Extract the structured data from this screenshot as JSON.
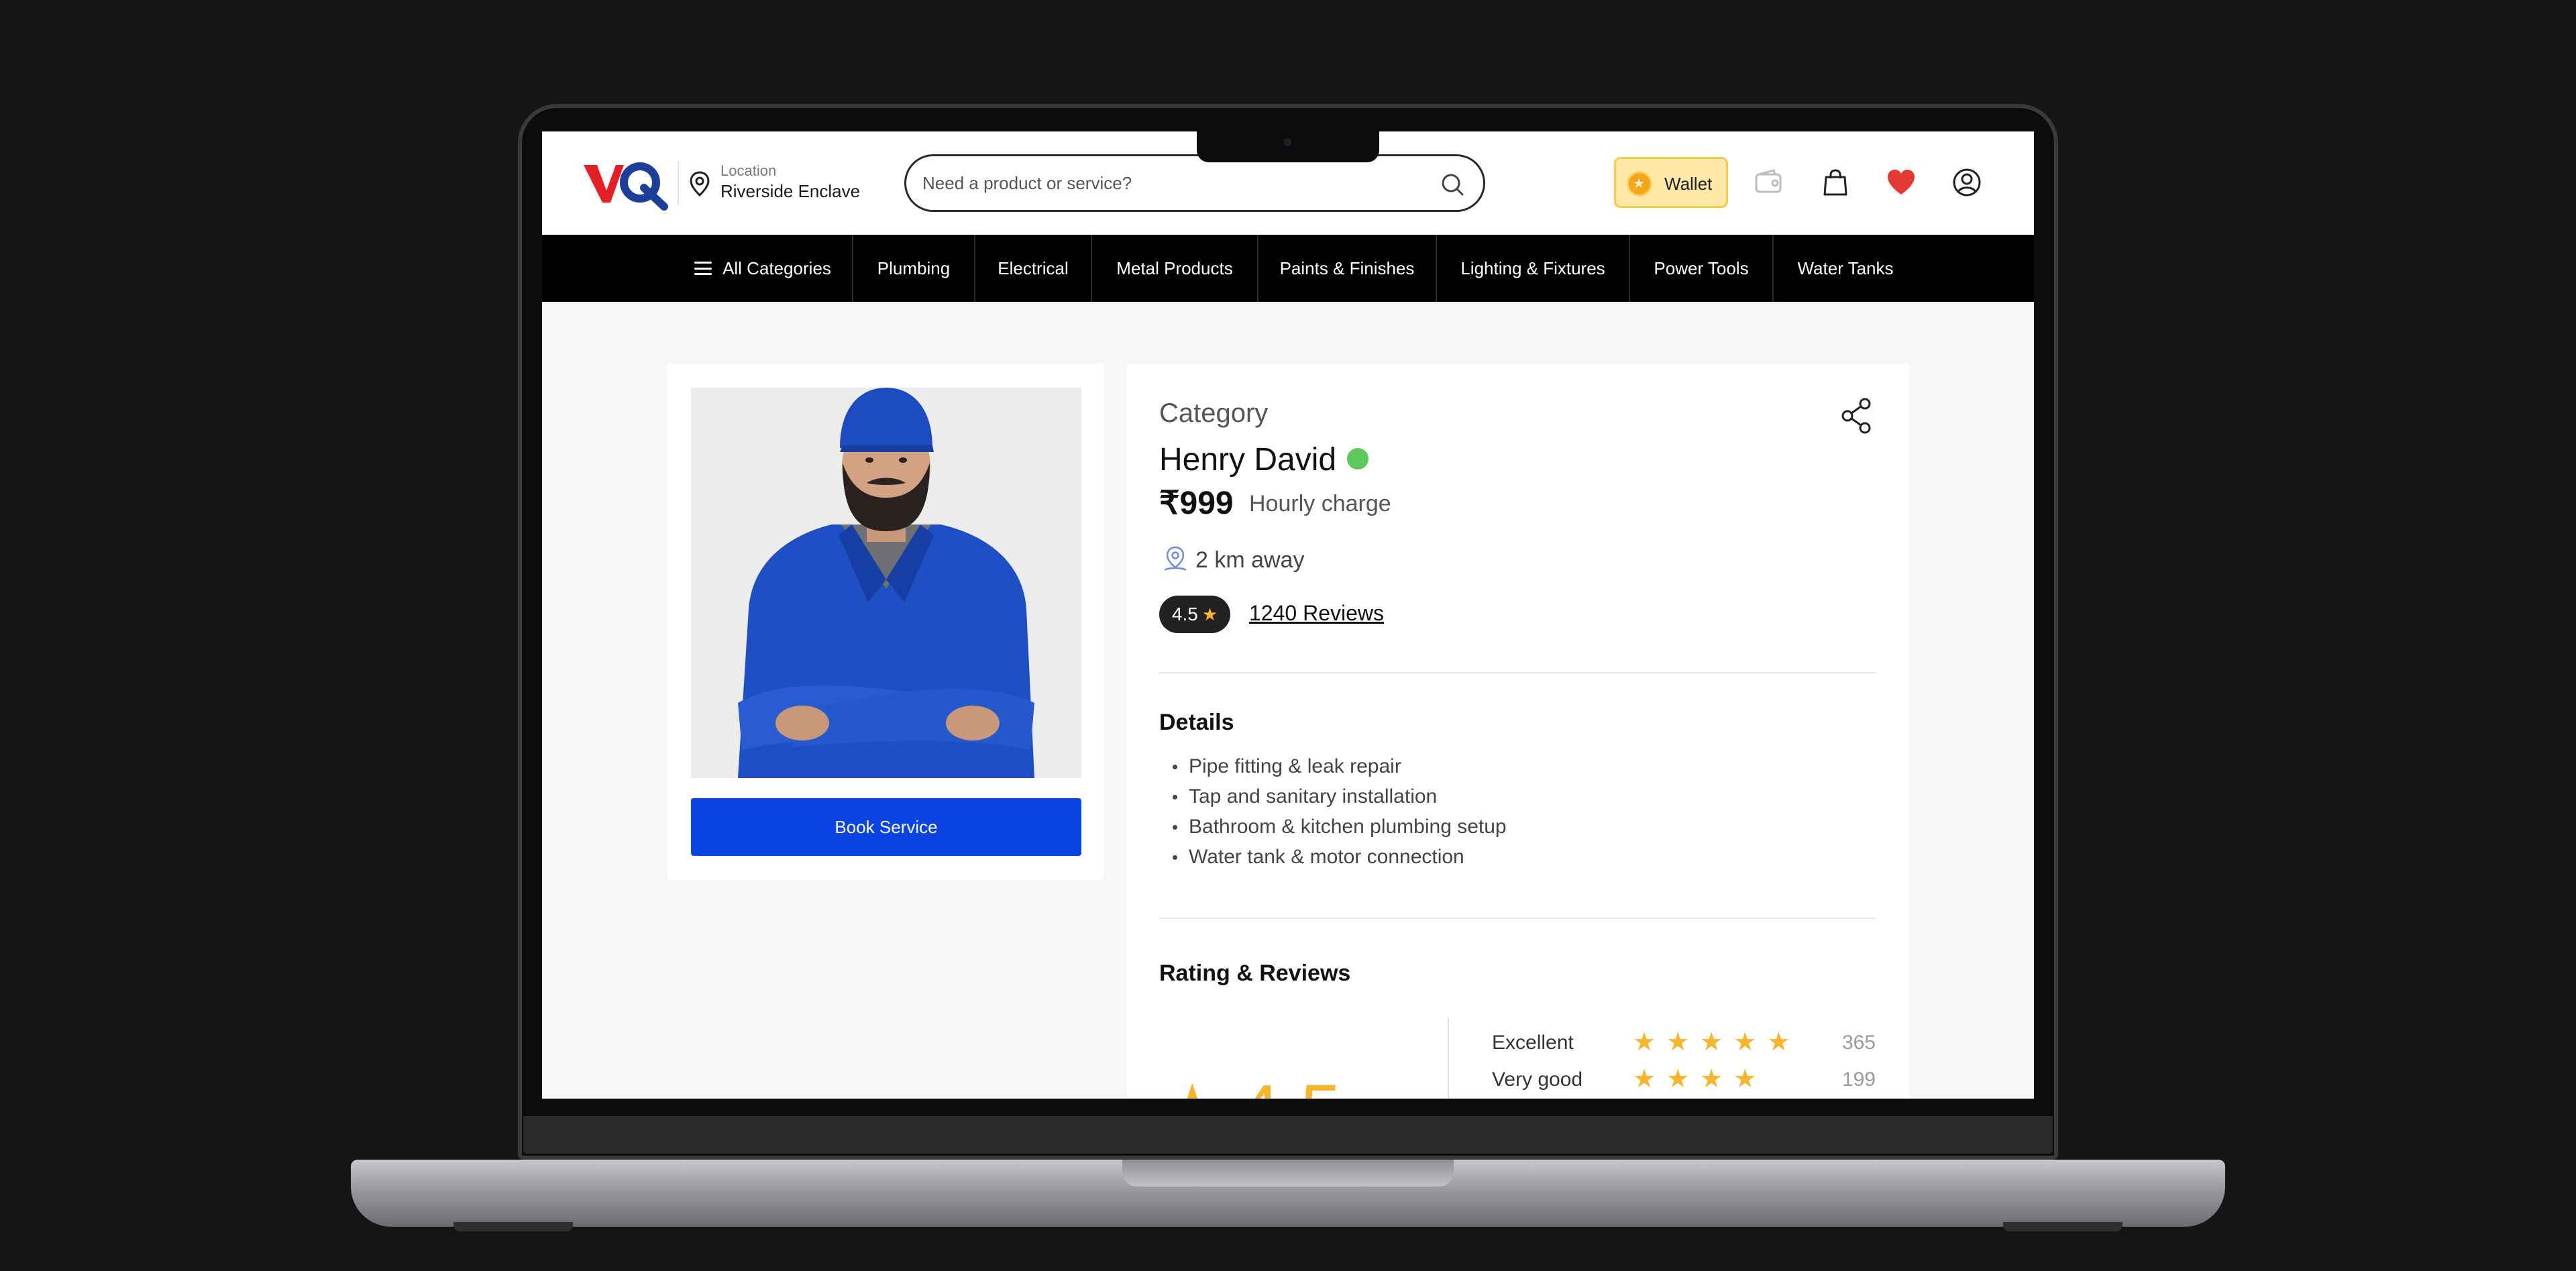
{
  "header": {
    "location_label": "Location",
    "location_value": "Riverside Enclave",
    "search_placeholder": "Need a product or service?",
    "wallet_label": "Wallet",
    "brand_colors": {
      "logo_red": "#e31e24",
      "logo_blue": "#1d3f9a"
    }
  },
  "categories": {
    "all_label": "All Categories",
    "items": [
      "Plumbing",
      "Electrical",
      "Metal Products",
      "Paints & Finishes",
      "Lighting & Fixtures",
      "Power Tools",
      "Water Tanks"
    ]
  },
  "service": {
    "category": "Category",
    "name": "Henry David",
    "status_color": "#5cc85c",
    "price": "₹999",
    "price_unit": "Hourly charge",
    "distance": "2 km away",
    "rating": "4.5",
    "reviews_label": "1240 Reviews",
    "book_label": "Book Service"
  },
  "details": {
    "title": "Details",
    "items": [
      "Pipe fitting & leak repair",
      "Tap and sanitary installation",
      "Bathroom & kitchen plumbing setup",
      "Water tank & motor connection"
    ]
  },
  "reviews": {
    "title": "Rating & Reviews",
    "overall": "4.5",
    "breakdown": [
      {
        "label": "Excellent",
        "stars": 5,
        "count": "365"
      },
      {
        "label": "Very good",
        "stars": 4,
        "count": "199"
      }
    ]
  },
  "colors": {
    "accent_blue": "#0c44e4",
    "star": "#f7b42c",
    "nav_bg": "#000000"
  }
}
